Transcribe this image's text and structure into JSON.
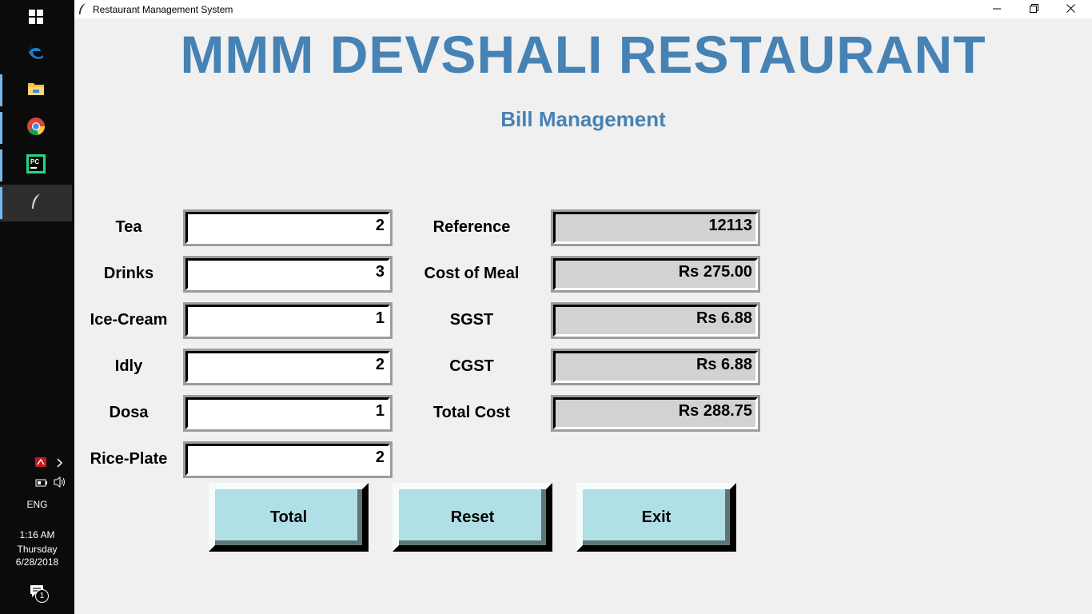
{
  "window": {
    "title": "Restaurant Management System"
  },
  "app": {
    "heading": "MMM DEVSHALI RESTAURANT",
    "subheading": "Bill Management",
    "accent_color": "#4682b4"
  },
  "items": [
    {
      "label": "Tea",
      "value": "2"
    },
    {
      "label": "Drinks",
      "value": "3"
    },
    {
      "label": "Ice-Cream",
      "value": "1"
    },
    {
      "label": "Idly",
      "value": "2"
    },
    {
      "label": "Dosa",
      "value": "1"
    },
    {
      "label": "Rice-Plate",
      "value": "2"
    }
  ],
  "bill": [
    {
      "label": "Reference",
      "value": "12113"
    },
    {
      "label": "Cost of Meal",
      "value": "Rs 275.00"
    },
    {
      "label": "SGST",
      "value": "Rs 6.88"
    },
    {
      "label": "CGST",
      "value": "Rs 6.88"
    },
    {
      "label": "Total Cost",
      "value": "Rs 288.75"
    }
  ],
  "buttons": {
    "total": "Total",
    "reset": "Reset",
    "exit": "Exit",
    "color": "#b0dfe5"
  },
  "taskbar": {
    "language": "ENG",
    "time": "1:16 AM",
    "day": "Thursday",
    "date": "6/28/2018",
    "notification_count": "1",
    "icons": [
      "windows-start-icon",
      "edge-icon",
      "file-explorer-icon",
      "chrome-icon",
      "pycharm-icon",
      "tk-feather-icon"
    ]
  }
}
